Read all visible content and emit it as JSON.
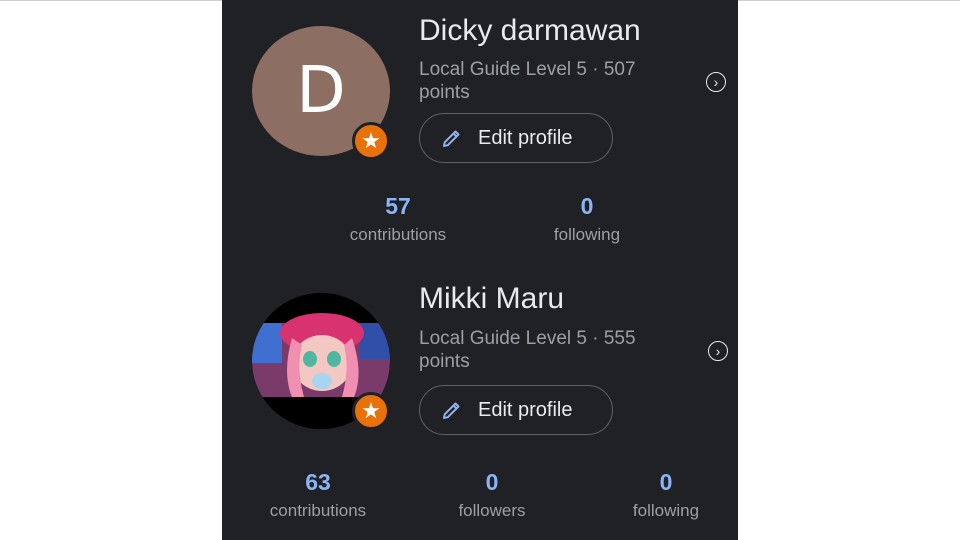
{
  "profiles": [
    {
      "avatar_letter": "D",
      "avatar_color": "#8d6e63",
      "name": "Dicky darmawan",
      "level": "Local Guide Level 5 · 507 points",
      "edit_label": "Edit profile",
      "badge_icon": "star-icon",
      "stats": [
        {
          "value": "57",
          "label": "contributions"
        },
        {
          "value": "0",
          "label": "following"
        }
      ]
    },
    {
      "avatar_type": "photo",
      "name": "Mikki Maru",
      "level": "Local Guide Level 5 · 555 points",
      "edit_label": "Edit profile",
      "badge_icon": "star-icon",
      "stats": [
        {
          "value": "63",
          "label": "contributions"
        },
        {
          "value": "0",
          "label": "followers"
        },
        {
          "value": "0",
          "label": "following"
        }
      ]
    }
  ],
  "colors": {
    "background": "#202124",
    "accent_blue": "#8ab4f8",
    "badge_orange": "#e8710a"
  }
}
